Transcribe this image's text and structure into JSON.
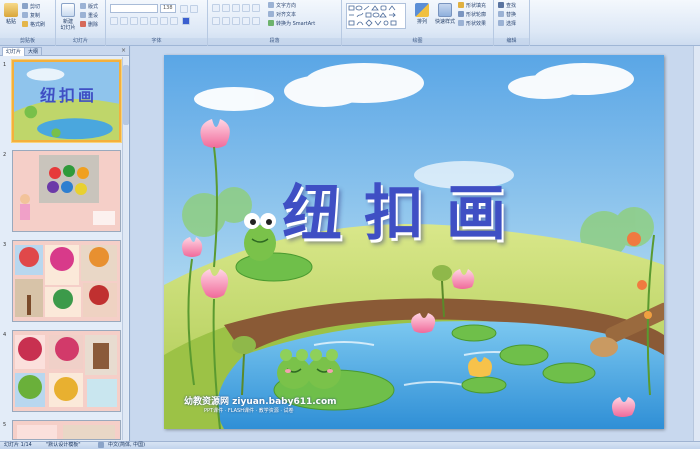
{
  "ribbon": {
    "groups": [
      {
        "label": "剪贴板"
      },
      {
        "label": "幻灯片"
      },
      {
        "label": "字体"
      },
      {
        "label": "段落"
      },
      {
        "label": "绘图"
      },
      {
        "label": "编辑"
      }
    ],
    "paste_label": "粘贴",
    "cut_label": "剪切",
    "copy_label": "复制",
    "format_painter_label": "格式刷",
    "new_slide_label": "新建\n幻灯片",
    "layout_label": "版式",
    "reset_label": "重设",
    "delete_label": "删除",
    "font_size_value": "138",
    "text_direction_label": "文字方向",
    "align_text_label": "对齐文本",
    "smartart_label": "转换为 SmartArt",
    "arrange_label": "排列",
    "quick_styles_label": "快速样式",
    "shape_fill_label": "形状填充",
    "shape_outline_label": "形状轮廓",
    "shape_effects_label": "形状效果",
    "find_label": "查找",
    "replace_label": "替换",
    "select_label": "选择"
  },
  "left_pane": {
    "tab_slides": "幻灯片",
    "tab_outline": "大纲",
    "close_symbol": "×",
    "thumbnails": [
      {
        "num": "1",
        "title": "纽扣画"
      },
      {
        "num": "2"
      },
      {
        "num": "3"
      },
      {
        "num": "4"
      },
      {
        "num": "5"
      }
    ]
  },
  "slide": {
    "title": "纽扣画",
    "watermark": "幼教资源网 ziyuan.baby611.com",
    "watermark_sub": "PPT课件 · FLASH课件 · 教学资源 · 试卷"
  },
  "status_bar": {
    "slide_info": "幻灯片 1/14",
    "theme": "\"默认设计模板\"",
    "language": "中文(简体, 中国)"
  },
  "colors": {
    "ribbon_bg": "#dde8f6",
    "title_color": "#3f4fc4",
    "selected_border": "#f4b03d"
  }
}
